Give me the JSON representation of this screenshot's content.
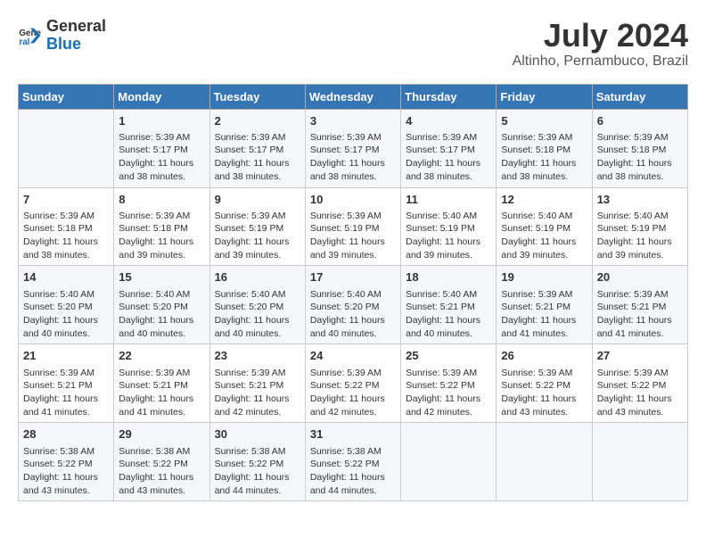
{
  "header": {
    "logo_line1": "General",
    "logo_line2": "Blue",
    "month": "July 2024",
    "location": "Altinho, Pernambuco, Brazil"
  },
  "weekdays": [
    "Sunday",
    "Monday",
    "Tuesday",
    "Wednesday",
    "Thursday",
    "Friday",
    "Saturday"
  ],
  "weeks": [
    [
      {
        "day": "",
        "info": ""
      },
      {
        "day": "1",
        "info": "Sunrise: 5:39 AM\nSunset: 5:17 PM\nDaylight: 11 hours and 38 minutes."
      },
      {
        "day": "2",
        "info": "Sunrise: 5:39 AM\nSunset: 5:17 PM\nDaylight: 11 hours and 38 minutes."
      },
      {
        "day": "3",
        "info": "Sunrise: 5:39 AM\nSunset: 5:17 PM\nDaylight: 11 hours and 38 minutes."
      },
      {
        "day": "4",
        "info": "Sunrise: 5:39 AM\nSunset: 5:17 PM\nDaylight: 11 hours and 38 minutes."
      },
      {
        "day": "5",
        "info": "Sunrise: 5:39 AM\nSunset: 5:18 PM\nDaylight: 11 hours and 38 minutes."
      },
      {
        "day": "6",
        "info": "Sunrise: 5:39 AM\nSunset: 5:18 PM\nDaylight: 11 hours and 38 minutes."
      }
    ],
    [
      {
        "day": "7",
        "info": "Sunrise: 5:39 AM\nSunset: 5:18 PM\nDaylight: 11 hours and 38 minutes."
      },
      {
        "day": "8",
        "info": "Sunrise: 5:39 AM\nSunset: 5:18 PM\nDaylight: 11 hours and 39 minutes."
      },
      {
        "day": "9",
        "info": "Sunrise: 5:39 AM\nSunset: 5:19 PM\nDaylight: 11 hours and 39 minutes."
      },
      {
        "day": "10",
        "info": "Sunrise: 5:39 AM\nSunset: 5:19 PM\nDaylight: 11 hours and 39 minutes."
      },
      {
        "day": "11",
        "info": "Sunrise: 5:40 AM\nSunset: 5:19 PM\nDaylight: 11 hours and 39 minutes."
      },
      {
        "day": "12",
        "info": "Sunrise: 5:40 AM\nSunset: 5:19 PM\nDaylight: 11 hours and 39 minutes."
      },
      {
        "day": "13",
        "info": "Sunrise: 5:40 AM\nSunset: 5:19 PM\nDaylight: 11 hours and 39 minutes."
      }
    ],
    [
      {
        "day": "14",
        "info": "Sunrise: 5:40 AM\nSunset: 5:20 PM\nDaylight: 11 hours and 40 minutes."
      },
      {
        "day": "15",
        "info": "Sunrise: 5:40 AM\nSunset: 5:20 PM\nDaylight: 11 hours and 40 minutes."
      },
      {
        "day": "16",
        "info": "Sunrise: 5:40 AM\nSunset: 5:20 PM\nDaylight: 11 hours and 40 minutes."
      },
      {
        "day": "17",
        "info": "Sunrise: 5:40 AM\nSunset: 5:20 PM\nDaylight: 11 hours and 40 minutes."
      },
      {
        "day": "18",
        "info": "Sunrise: 5:40 AM\nSunset: 5:21 PM\nDaylight: 11 hours and 40 minutes."
      },
      {
        "day": "19",
        "info": "Sunrise: 5:39 AM\nSunset: 5:21 PM\nDaylight: 11 hours and 41 minutes."
      },
      {
        "day": "20",
        "info": "Sunrise: 5:39 AM\nSunset: 5:21 PM\nDaylight: 11 hours and 41 minutes."
      }
    ],
    [
      {
        "day": "21",
        "info": "Sunrise: 5:39 AM\nSunset: 5:21 PM\nDaylight: 11 hours and 41 minutes."
      },
      {
        "day": "22",
        "info": "Sunrise: 5:39 AM\nSunset: 5:21 PM\nDaylight: 11 hours and 41 minutes."
      },
      {
        "day": "23",
        "info": "Sunrise: 5:39 AM\nSunset: 5:21 PM\nDaylight: 11 hours and 42 minutes."
      },
      {
        "day": "24",
        "info": "Sunrise: 5:39 AM\nSunset: 5:22 PM\nDaylight: 11 hours and 42 minutes."
      },
      {
        "day": "25",
        "info": "Sunrise: 5:39 AM\nSunset: 5:22 PM\nDaylight: 11 hours and 42 minutes."
      },
      {
        "day": "26",
        "info": "Sunrise: 5:39 AM\nSunset: 5:22 PM\nDaylight: 11 hours and 43 minutes."
      },
      {
        "day": "27",
        "info": "Sunrise: 5:39 AM\nSunset: 5:22 PM\nDaylight: 11 hours and 43 minutes."
      }
    ],
    [
      {
        "day": "28",
        "info": "Sunrise: 5:38 AM\nSunset: 5:22 PM\nDaylight: 11 hours and 43 minutes."
      },
      {
        "day": "29",
        "info": "Sunrise: 5:38 AM\nSunset: 5:22 PM\nDaylight: 11 hours and 43 minutes."
      },
      {
        "day": "30",
        "info": "Sunrise: 5:38 AM\nSunset: 5:22 PM\nDaylight: 11 hours and 44 minutes."
      },
      {
        "day": "31",
        "info": "Sunrise: 5:38 AM\nSunset: 5:22 PM\nDaylight: 11 hours and 44 minutes."
      },
      {
        "day": "",
        "info": ""
      },
      {
        "day": "",
        "info": ""
      },
      {
        "day": "",
        "info": ""
      }
    ]
  ]
}
